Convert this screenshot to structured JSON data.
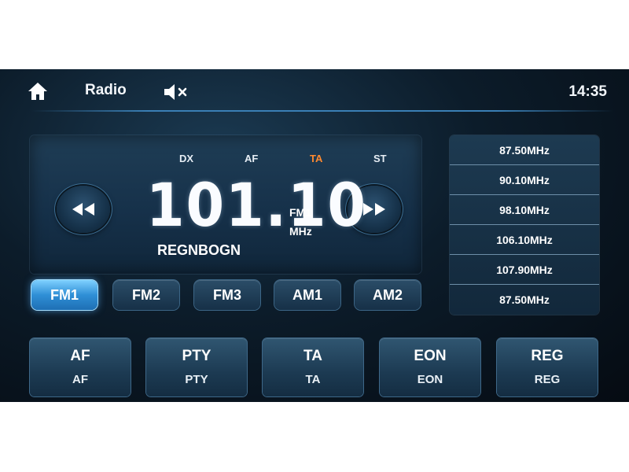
{
  "header": {
    "title": "Radio",
    "clock": "14:35",
    "home_icon": "home-icon",
    "mute_icon": "speaker-mute-icon"
  },
  "indicators": [
    {
      "label": "DX",
      "color": "#e6edf4"
    },
    {
      "label": "AF",
      "color": "#e6edf4"
    },
    {
      "label": "TA",
      "color": "#ff8a30"
    },
    {
      "label": "ST",
      "color": "#e6edf4"
    }
  ],
  "tuner": {
    "frequency": "101.10",
    "band": "FM1",
    "unit": "MHz",
    "station": "REGNBOGN",
    "seek_back_icon": "rewind-icon",
    "seek_forward_icon": "fast-forward-icon"
  },
  "bands": [
    {
      "label": "FM1",
      "active": true
    },
    {
      "label": "FM2",
      "active": false
    },
    {
      "label": "FM3",
      "active": false
    },
    {
      "label": "AM1",
      "active": false
    },
    {
      "label": "AM2",
      "active": false
    }
  ],
  "presets": [
    "87.50MHz",
    "90.10MHz",
    "98.10MHz",
    "106.10MHz",
    "107.90MHz",
    "87.50MHz"
  ],
  "functions": [
    {
      "label": "AF",
      "sub": "AF"
    },
    {
      "label": "PTY",
      "sub": "PTY"
    },
    {
      "label": "TA",
      "sub": "TA"
    },
    {
      "label": "EON",
      "sub": "EON"
    },
    {
      "label": "REG",
      "sub": "REG"
    }
  ],
  "colors": {
    "accent": "#2f8fd6",
    "ta_active": "#ff8a30"
  }
}
